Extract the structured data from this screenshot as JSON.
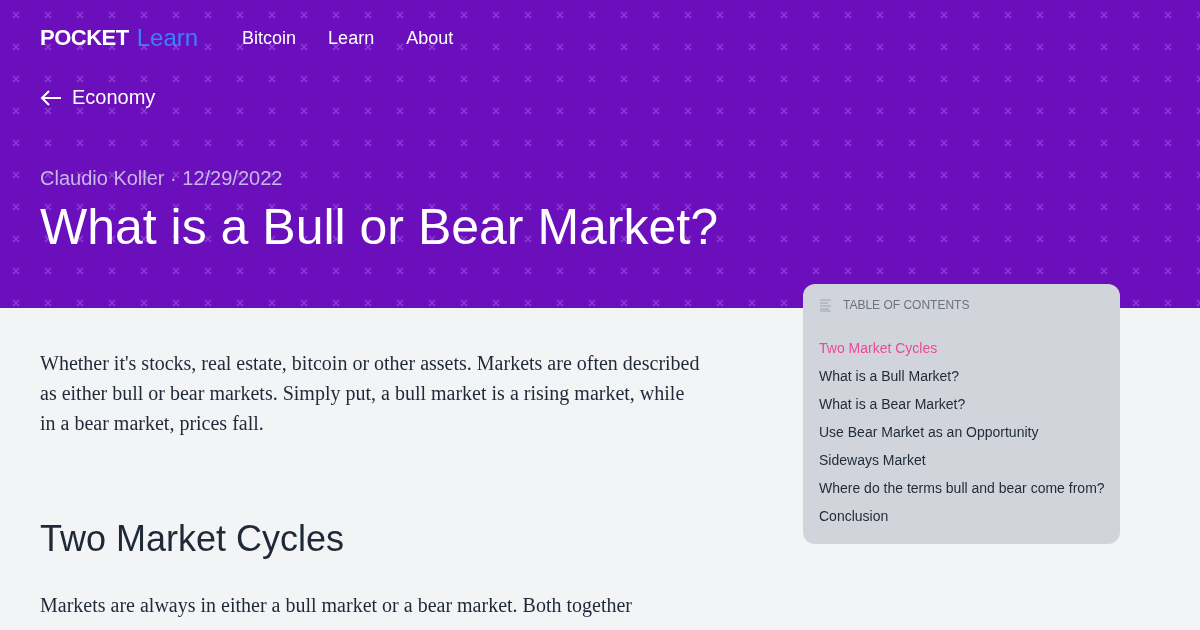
{
  "header": {
    "logo": "POCKET",
    "logo_suffix": "Learn",
    "nav": [
      "Bitcoin",
      "Learn",
      "About"
    ]
  },
  "back_link": "Economy",
  "byline": "Claudio Koller · 12/29/2022",
  "title": "What is a Bull or Bear Market?",
  "toc": {
    "heading": "TABLE OF CONTENTS",
    "items": [
      {
        "label": "Two Market Cycles",
        "selected": true
      },
      {
        "label": "What is a Bull Market?",
        "selected": false
      },
      {
        "label": "What is a Bear Market?",
        "selected": false
      },
      {
        "label": "Use Bear Market as an Opportunity",
        "selected": false
      },
      {
        "label": "Sideways Market",
        "selected": false
      },
      {
        "label": "Where do the terms bull and bear come from?",
        "selected": false
      },
      {
        "label": "Conclusion",
        "selected": false
      }
    ]
  },
  "article": [
    {
      "kind": "paragraph",
      "text": "Whether it's stocks, real estate, bitcoin or other assets. Markets are often described as either bull or bear markets. Simply put, a bull market is a rising market, while in a bear market, prices fall."
    },
    {
      "kind": "heading",
      "text": "Two Market Cycles"
    },
    {
      "kind": "paragraph",
      "text": "Markets are always in either a bull market or a bear market. Both together"
    }
  ]
}
